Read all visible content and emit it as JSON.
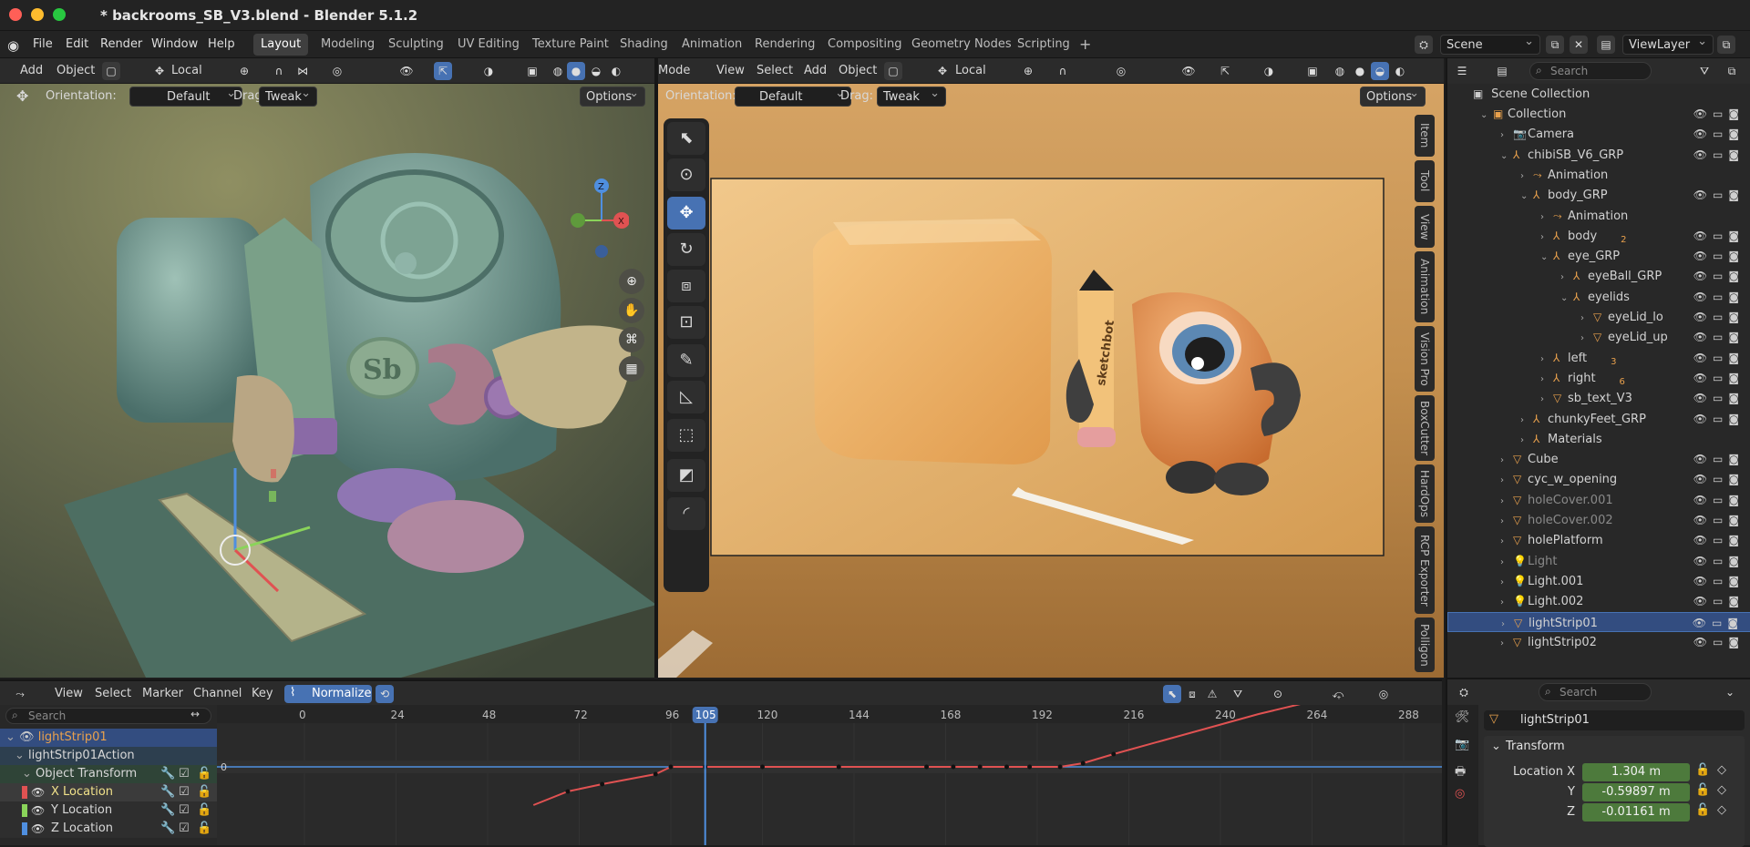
{
  "window": {
    "title": "* backrooms_SB_V3.blend - Blender 5.1.2",
    "close_color": "#ff5f57",
    "min_color": "#febc2e",
    "max_color": "#28c840"
  },
  "menu": {
    "items": [
      "File",
      "Edit",
      "Render",
      "Window",
      "Help"
    ],
    "workspaces": [
      "Layout",
      "Modeling",
      "Sculpting",
      "UV Editing",
      "Texture Paint",
      "Shading",
      "Animation",
      "Rendering",
      "Compositing",
      "Geometry Nodes",
      "Scripting"
    ],
    "active_workspace": "Layout",
    "add_tab": "+",
    "scene": "Scene",
    "view_layer": "ViewLayer"
  },
  "viewport_left": {
    "header": {
      "add": "Add",
      "object": "Object",
      "transform": "Local"
    },
    "orientation_label": "Orientation:",
    "orientation_value": "Default",
    "drag_label": "Drag:",
    "drag_value": "Tweak",
    "options": "Options",
    "gizmo": {
      "z": "Z",
      "x": "X"
    },
    "emblem": "Sb"
  },
  "viewport_right": {
    "header": {
      "mode": "Mode",
      "view": "View",
      "select": "Select",
      "add": "Add",
      "object": "Object",
      "transform": "Local"
    },
    "orientation_label": "Orientation:",
    "orientation_value": "Default",
    "drag_label": "Drag:",
    "drag_value": "Tweak",
    "options": "Options",
    "side_tabs": [
      "Item",
      "Tool",
      "View",
      "Animation",
      "Vision Pro",
      "BoxCutter",
      "HardOps",
      "RCP Exporter",
      "Polligon"
    ],
    "pencil_text": "sketchbot"
  },
  "outliner": {
    "search_placeholder": "Search",
    "root": "Scene Collection",
    "rows": [
      {
        "label": "Collection",
        "indent": 1,
        "type": "▣",
        "open": true
      },
      {
        "label": "Camera",
        "indent": 2,
        "type": "📷",
        "open": false
      },
      {
        "label": "chibiSB_V6_GRP",
        "indent": 2,
        "type": "⅄",
        "open": true
      },
      {
        "label": "Animation",
        "indent": 3,
        "type": "⤳",
        "open": false
      },
      {
        "label": "body_GRP",
        "indent": 3,
        "type": "⅄",
        "open": true
      },
      {
        "label": "Animation",
        "indent": 4,
        "type": "⤳",
        "open": false
      },
      {
        "label": "body",
        "indent": 4,
        "type": "⅄",
        "open": false,
        "badge": "2"
      },
      {
        "label": "eye_GRP",
        "indent": 4,
        "type": "⅄",
        "open": true
      },
      {
        "label": "eyeBall_GRP",
        "indent": 5,
        "type": "⅄",
        "open": false
      },
      {
        "label": "eyelids",
        "indent": 5,
        "type": "⅄",
        "open": true
      },
      {
        "label": "eyeLid_lo",
        "indent": 6,
        "type": "▽",
        "open": false
      },
      {
        "label": "eyeLid_up",
        "indent": 6,
        "type": "▽",
        "open": false
      },
      {
        "label": "left",
        "indent": 4,
        "type": "⅄",
        "open": false,
        "badge": "3"
      },
      {
        "label": "right",
        "indent": 4,
        "type": "⅄",
        "open": false,
        "badge": "6"
      },
      {
        "label": "sb_text_V3",
        "indent": 4,
        "type": "▽",
        "open": false
      },
      {
        "label": "chunkyFeet_GRP",
        "indent": 3,
        "type": "⅄",
        "open": false
      },
      {
        "label": "Materials",
        "indent": 3,
        "type": "⅄",
        "open": false
      },
      {
        "label": "Cube",
        "indent": 2,
        "type": "▽",
        "open": false
      },
      {
        "label": "cyc_w_opening",
        "indent": 2,
        "type": "▽",
        "open": false
      },
      {
        "label": "holeCover.001",
        "indent": 2,
        "type": "▽",
        "open": false,
        "dim": true
      },
      {
        "label": "holeCover.002",
        "indent": 2,
        "type": "▽",
        "open": false,
        "dim": true
      },
      {
        "label": "holePlatform",
        "indent": 2,
        "type": "▽",
        "open": false
      },
      {
        "label": "Light",
        "indent": 2,
        "type": "💡",
        "open": false,
        "dim": true
      },
      {
        "label": "Light.001",
        "indent": 2,
        "type": "💡",
        "open": false
      },
      {
        "label": "Light.002",
        "indent": 2,
        "type": "💡",
        "open": false
      },
      {
        "label": "lightStrip01",
        "indent": 2,
        "type": "▽",
        "open": false,
        "selected": true
      },
      {
        "label": "lightStrip02",
        "indent": 2,
        "type": "▽",
        "open": false
      }
    ]
  },
  "properties": {
    "search_placeholder": "Search",
    "object_name": "lightStrip01",
    "panel": "Transform",
    "location_label": "Location X",
    "y_label": "Y",
    "z_label": "Z",
    "x": "1.304 m",
    "y": "-0.59897 m",
    "z": "-0.01161 m"
  },
  "graph_editor": {
    "menu": [
      "View",
      "Select",
      "Marker",
      "Channel",
      "Key"
    ],
    "normalize": "Normalize",
    "search_placeholder": "Search",
    "current_frame": "105",
    "frame_ticks": [
      "0",
      "24",
      "48",
      "72",
      "96",
      "120",
      "144",
      "168",
      "192",
      "216",
      "240",
      "264",
      "288"
    ],
    "zero_label": "0",
    "channels": [
      {
        "label": "lightStrip01",
        "kind": "object"
      },
      {
        "label": "lightStrip01Action",
        "kind": "action"
      },
      {
        "label": "Object Transform",
        "kind": "group"
      },
      {
        "label": "X Location",
        "kind": "curve",
        "color": "#e05252"
      },
      {
        "label": "Y Location",
        "kind": "curve",
        "color": "#8ad45a"
      },
      {
        "label": "Z Location",
        "kind": "curve",
        "color": "#4f8fe0"
      }
    ]
  }
}
